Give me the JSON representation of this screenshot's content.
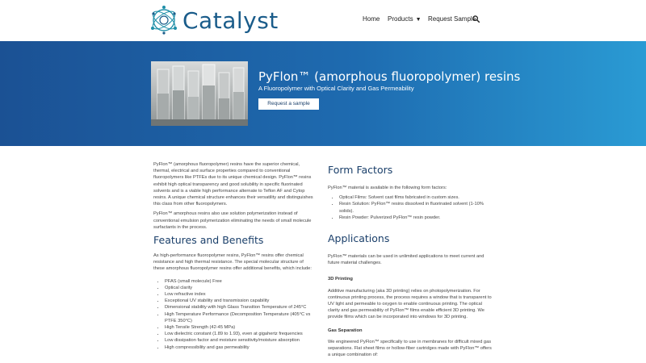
{
  "header": {
    "brand": "Catalyst",
    "nav": {
      "home": "Home",
      "products": "Products",
      "request_sample": "Request Sample"
    }
  },
  "hero": {
    "title": "PyFlon™ (amorphous fluoropolymer) resins",
    "subtitle": "A Fluoropolymer with Optical Clarity and Gas Permeability",
    "button": "Request a sample"
  },
  "intro": {
    "p1": "PyFlon™ (amorphous fluoropolymer) resins have the superior chemical, thermal, electrical and surface properties compared to conventional fluoropolymers like PTFEs due to its unique chemical design.   PyFlon™ resins exhibit high optical transparency and good solubility in specific fluorinated solvents and is a viable high performance alternate to Teflon AF and Cytop resins. A unique chemical structure enhances their versatility and distinguishes this class from other fluoropolymers.",
    "p2": "PyFlon™ amorphous resins also use solution polymerization instead of conventional emulsion polymerization eliminating the needs of small molecule surfactants in the process."
  },
  "features": {
    "heading": "Features and Benefits",
    "intro": "As high-performance fluoropolymer resins, PyFlon™ resins offer chemical resistance and high thermal resistance. The special molecular structure of these amorphous fluoropolymer resins offer additional benefits, which include:",
    "items": [
      "PFAS (small molecule) Free",
      "Optical clarity",
      "Low refractive index",
      "Exceptional UV stability and transmission capability",
      "Dimensional stability with high Glass Transition Temperature of 245°C",
      "High Temperature Performance (Decomposition Temperature (405°C vs PTFE 350°C)",
      "High Tensile Strength (42-45 MPa)",
      "Low dielectric constant (1.89 to 1.93), even at gigahertz frequencies",
      "Low dissipation factor and moisture sensitivity/moisture absorption",
      "High compressibility and gas permeability"
    ]
  },
  "form_factors": {
    "heading": "Form Factors",
    "intro": "PyFlon™ material is available in the following form factors:",
    "items": [
      "Optical Films:  Solvent cast films fabricated in custom sizes.",
      "Resin Solution: PyFlon™ resins dissolved in fluorinated solvent (1-10% solids).",
      "Resin Powder: Pulverized PyFlon™ resin powder."
    ]
  },
  "applications": {
    "heading": "Applications",
    "intro": "PyFlon™ materials can be used in unlimited applications to meet current and future material challenges.",
    "printing": {
      "heading": "3D Printing",
      "text": "Additive manufacturing (aka 3D printing) relies on photopolymerization. For continuous printing process, the process requires a window that is transparent to UV light and permeable to oxygen to enable continuous printing. The optical clarity and gas permeability of PyFlon™ films enable efficient 3D printing.  We provide films which can be incorporated into windows for 3D printing."
    },
    "gas": {
      "heading": "Gas Separation",
      "text": "We engineered PyFlon™ specifically to use in membranes for difficult mixed gas separations.  Flat sheet films or hollow-fiber cartridges made with PyFlon™ offers a unique combination of:"
    }
  },
  "colors": {
    "brand": "#1a5c8a",
    "heading": "#1a3f6a",
    "hero_start": "#1b5194",
    "hero_end": "#2a9bd4"
  }
}
